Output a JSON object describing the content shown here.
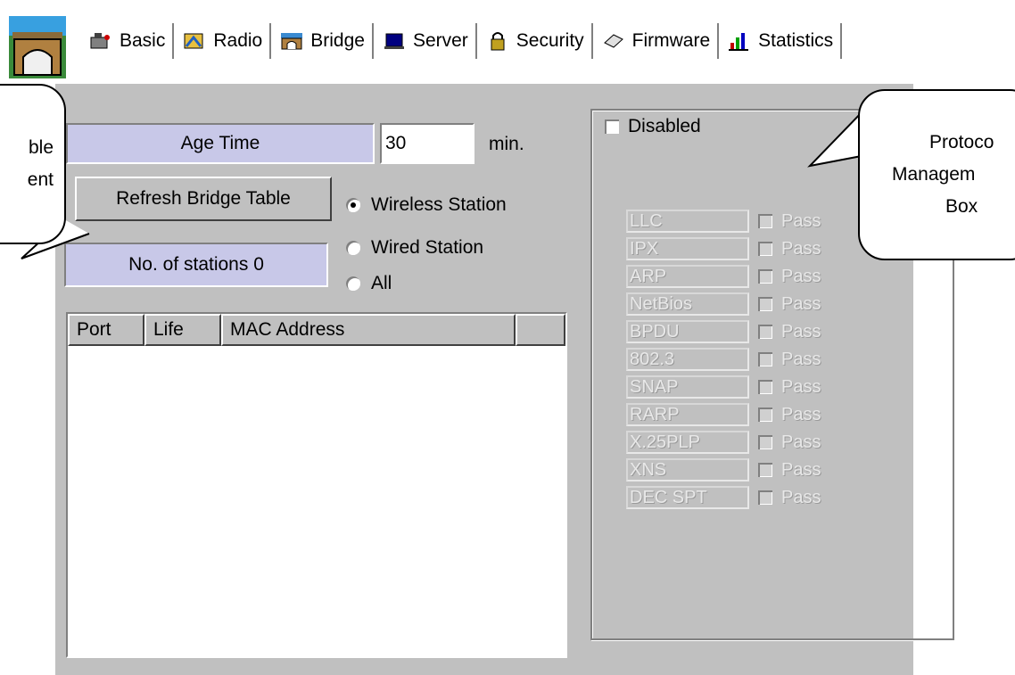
{
  "toolbar": {
    "tabs": [
      {
        "label": "Basic",
        "icon": "basic-icon"
      },
      {
        "label": "Radio",
        "icon": "radio-icon"
      },
      {
        "label": "Bridge",
        "icon": "bridge-icon"
      },
      {
        "label": "Server",
        "icon": "server-icon"
      },
      {
        "label": "Security",
        "icon": "security-icon"
      },
      {
        "label": "Firmware",
        "icon": "firmware-icon"
      },
      {
        "label": "Statistics",
        "icon": "statistics-icon"
      }
    ],
    "active_tab": "Bridge"
  },
  "bridge": {
    "age_time_label": "Age Time",
    "age_time_value": "30",
    "age_time_unit": "min.",
    "refresh_button": "Refresh Bridge Table",
    "stations_label": "No. of stations 0",
    "filter_options": [
      "Wireless Station",
      "Wired Station",
      "All"
    ],
    "filter_selected": "Wireless Station",
    "table_columns": [
      "Port",
      "Life",
      "MAC Address",
      ""
    ]
  },
  "protocol": {
    "disabled_label": "Disabled",
    "disabled_checked": false,
    "pass_label": "Pass",
    "protocols": [
      "LLC",
      "IPX",
      "ARP",
      "NetBios",
      "BPDU",
      "802.3",
      "SNAP",
      "RARP",
      "X.25PLP",
      "XNS",
      "DEC SPT"
    ]
  },
  "callouts": {
    "left_line1": "ble",
    "left_line2": "ent",
    "right_line1": "Protoco",
    "right_line2": "Managem",
    "right_line3": "Box"
  },
  "colors": {
    "panel": "#c0c0c0",
    "label_box": "#c8c8e8"
  }
}
